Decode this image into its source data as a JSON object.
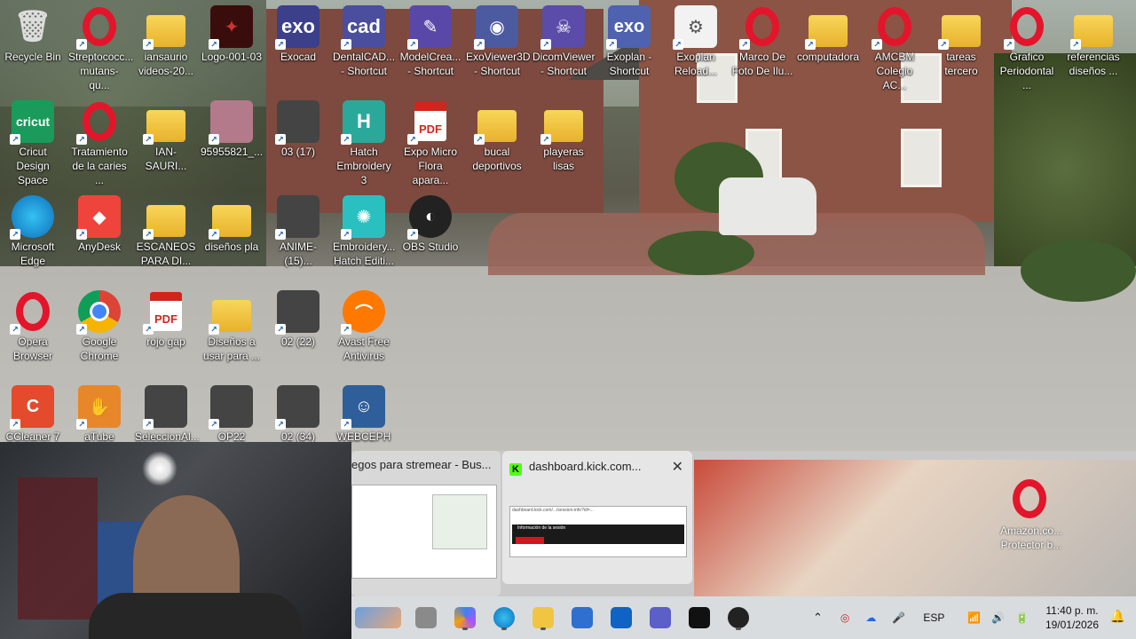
{
  "desktop": {
    "icons": [
      {
        "label": "Recycle Bin",
        "icon": "recycle-bin-icon"
      },
      {
        "label": "Streptococc... mutans- qu...",
        "icon": "opera-icon"
      },
      {
        "label": "iansaurio videos-20...",
        "icon": "folder-icon"
      },
      {
        "label": "Logo-001-03",
        "icon": "logo-icon"
      },
      {
        "label": "Exocad",
        "icon": "exocad-icon",
        "text": "exo"
      },
      {
        "label": "DentalCAD... - Shortcut",
        "icon": "dentalcad-icon",
        "text": "cad"
      },
      {
        "label": "ModelCrea... - Shortcut",
        "icon": "modelcreator-icon"
      },
      {
        "label": "ExoViewer3D - Shortcut",
        "icon": "exoviewer-icon"
      },
      {
        "label": "DicomViewer - Shortcut",
        "icon": "dicomviewer-icon"
      },
      {
        "label": "Exoplan - Shortcut",
        "icon": "exoplan-icon"
      },
      {
        "label": "Exoplan Reload...",
        "icon": "gear-icon"
      },
      {
        "label": "Marco De Foto De Ilu...",
        "icon": "opera-icon"
      },
      {
        "label": "computadora",
        "icon": "folder-icon"
      },
      {
        "label": "AMCBM Colegio AC...",
        "icon": "opera-icon"
      },
      {
        "label": "tareas tercero",
        "icon": "folder-icon"
      },
      {
        "label": "Grafico Periodontal ...",
        "icon": "opera-icon"
      },
      {
        "label": "referencias diseños ...",
        "icon": "folder-icon"
      },
      {
        "label": "Cricut Design Space",
        "icon": "cricut-icon",
        "text": "cricut"
      },
      {
        "label": "Tratamiento de la caries ...",
        "icon": "opera-icon"
      },
      {
        "label": "IAN-SAURI...",
        "icon": "folder-icon"
      },
      {
        "label": "95955821_...",
        "icon": "photo-icon"
      },
      {
        "label": "03 (17)",
        "icon": "image-icon"
      },
      {
        "label": "Hatch Embroidery 3",
        "icon": "hatch-icon",
        "text": "H"
      },
      {
        "label": "Expo Micro Flora apara...",
        "icon": "pdf-icon"
      },
      {
        "label": "bucal deportivos",
        "icon": "folder-icon"
      },
      {
        "label": "playeras lisas",
        "icon": "folder-icon"
      },
      {
        "label": "Microsoft Edge",
        "icon": "edge-icon"
      },
      {
        "label": "AnyDesk",
        "icon": "anydesk-icon"
      },
      {
        "label": "ESCANEOS PARA DI...",
        "icon": "folder-icon"
      },
      {
        "label": "diseños pla",
        "icon": "folder-icon"
      },
      {
        "label": "ANIME-(15)...",
        "icon": "image-icon"
      },
      {
        "label": "Embroidery... Hatch Editi...",
        "icon": "embroidery-icon"
      },
      {
        "label": "OBS Studio",
        "icon": "obs-icon"
      },
      {
        "label": "Opera Browser",
        "icon": "opera-icon"
      },
      {
        "label": "Google Chrome",
        "icon": "chrome-icon"
      },
      {
        "label": "rojo gap",
        "icon": "pdf-icon"
      },
      {
        "label": "Diseños a usar para ...",
        "icon": "folder-icon"
      },
      {
        "label": "02 (22)",
        "icon": "image-icon"
      },
      {
        "label": "Avast Free Antivirus",
        "icon": "avast-icon"
      },
      {
        "label": "CCleaner 7",
        "icon": "ccleaner-icon"
      },
      {
        "label": "aTube",
        "icon": "atube-icon"
      },
      {
        "label": "SeleccionAl...",
        "icon": "image-icon"
      },
      {
        "label": "OP22",
        "icon": "image-icon"
      },
      {
        "label": "02 (34)",
        "icon": "image-icon"
      },
      {
        "label": "WEBCEPH",
        "icon": "webceph-icon"
      }
    ]
  },
  "previews": {
    "left_title": "egos para stremear - Bus...",
    "active_title": "dashboard.kick.com...",
    "active_app_icon": "K",
    "close_glyph": "✕",
    "thumb_url": "dashboard.kick.com/.../session-info?id=...",
    "thumb_header": "Información de la sesión",
    "amazon_label": "Amazon.co... Protector b..."
  },
  "taskbar": {
    "apps": [
      "widgets-icon",
      "file-explorer-icon",
      "copilot-icon",
      "edge-icon",
      "folder-icon",
      "store-icon",
      "outlook-icon",
      "teams-icon",
      "tiktok-icon",
      "obs-icon"
    ],
    "tray": {
      "language": "ESP",
      "time": "11:40 p. m.",
      "date": "19/01/2026"
    }
  },
  "colors": {
    "opera_red": "#e3152b",
    "folder_yellow": "#f0c542",
    "kick_green": "#53fc18",
    "taskbar_bg": "#d9dcdf"
  }
}
